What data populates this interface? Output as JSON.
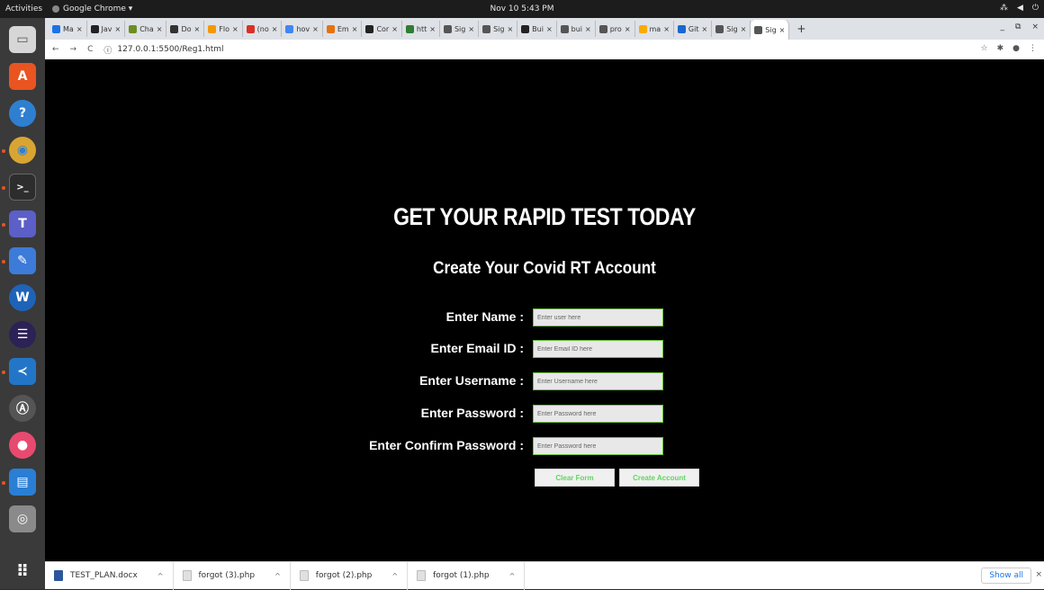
{
  "os": {
    "activities": "Activities",
    "app_name": "Google Chrome ▾",
    "clock": "Nov 10  5:43 PM",
    "tray": [
      "⁂",
      "◀",
      "⏻"
    ]
  },
  "dock": {
    "items": [
      {
        "name": "files",
        "glyph": "▭",
        "color": "#e0e0e0"
      },
      {
        "name": "software-center",
        "glyph": "A",
        "color": "#e95420"
      },
      {
        "name": "help",
        "glyph": "?",
        "color": "#2f7fd1"
      },
      {
        "name": "chrome",
        "glyph": "◉",
        "color": "#d9a532"
      },
      {
        "name": "terminal",
        "glyph": ">_",
        "color": "#2d2d2d"
      },
      {
        "name": "teams",
        "glyph": "T",
        "color": "#5b5fc7"
      },
      {
        "name": "text-editor",
        "glyph": "✎",
        "color": "#3d7bd9"
      },
      {
        "name": "webstorm",
        "glyph": "W",
        "color": "#1f63b8"
      },
      {
        "name": "eclipse",
        "glyph": "☰",
        "color": "#2c2255"
      },
      {
        "name": "vscode",
        "glyph": "≺",
        "color": "#2376c7"
      },
      {
        "name": "app-center",
        "glyph": "Ⓐ",
        "color": "#555555"
      },
      {
        "name": "color-app",
        "glyph": "●",
        "color": "#e84a6f"
      },
      {
        "name": "document-viewer",
        "glyph": "▤",
        "color": "#2a7fd4"
      },
      {
        "name": "disk",
        "glyph": "◎",
        "color": "#8a8a8a"
      }
    ],
    "apps_grid": "⠿"
  },
  "browser": {
    "tabs": [
      {
        "label": "Ma",
        "color": "#1a73e8"
      },
      {
        "label": "Jav",
        "color": "#222222"
      },
      {
        "label": "Cha",
        "color": "#6b8e23"
      },
      {
        "label": "Do",
        "color": "#333333"
      },
      {
        "label": "Flo",
        "color": "#f29900"
      },
      {
        "label": "(no",
        "color": "#d93025"
      },
      {
        "label": "hov",
        "color": "#4285f4"
      },
      {
        "label": "Em",
        "color": "#e8710a"
      },
      {
        "label": "Cor",
        "color": "#222222"
      },
      {
        "label": "htt",
        "color": "#2e7d32"
      },
      {
        "label": "Sig",
        "color": "#555555"
      },
      {
        "label": "Sig",
        "color": "#555555"
      },
      {
        "label": "Bui",
        "color": "#222222"
      },
      {
        "label": "bui",
        "color": "#555555"
      },
      {
        "label": "pro",
        "color": "#555555"
      },
      {
        "label": "ma",
        "color": "#f9ab00"
      },
      {
        "label": "Git",
        "color": "#1967d2"
      },
      {
        "label": "Sig",
        "color": "#555555"
      },
      {
        "label": "Sig",
        "color": "#555555",
        "active": true
      }
    ],
    "new_tab": "+",
    "url_info": "ⓘ",
    "url": "127.0.0.1:5500/Reg1.html",
    "nav": {
      "back": "←",
      "forward": "→",
      "reload": "C"
    },
    "window_controls": [
      "_",
      "⧉",
      "×"
    ],
    "addr_icons": [
      "☆",
      "✱",
      "●",
      "⋮"
    ]
  },
  "page": {
    "title": "GET YOUR RAPID TEST TODAY",
    "subtitle": "Create Your Covid RT Account",
    "fields": [
      {
        "label": "Enter Name :",
        "placeholder": "Enter user here"
      },
      {
        "label": "Enter Email ID :",
        "placeholder": "Enter Email ID here"
      },
      {
        "label": "Enter Username :",
        "placeholder": "Enter Username here"
      },
      {
        "label": "Enter Password :",
        "placeholder": "Enter Password here"
      },
      {
        "label": "Enter Confirm Password :",
        "placeholder": "Enter Password here"
      }
    ],
    "clear_label": "Clear Form",
    "create_label": "Create Account"
  },
  "downloads": {
    "items": [
      {
        "name": "TEST_PLAN.docx",
        "color": "#2b579a"
      },
      {
        "name": "forgot (3).php",
        "color": "#bdbdbd"
      },
      {
        "name": "forgot (2).php",
        "color": "#bdbdbd"
      },
      {
        "name": "forgot (1).php",
        "color": "#bdbdbd"
      }
    ],
    "chevron": "^",
    "show_all": "Show all",
    "close": "×"
  }
}
